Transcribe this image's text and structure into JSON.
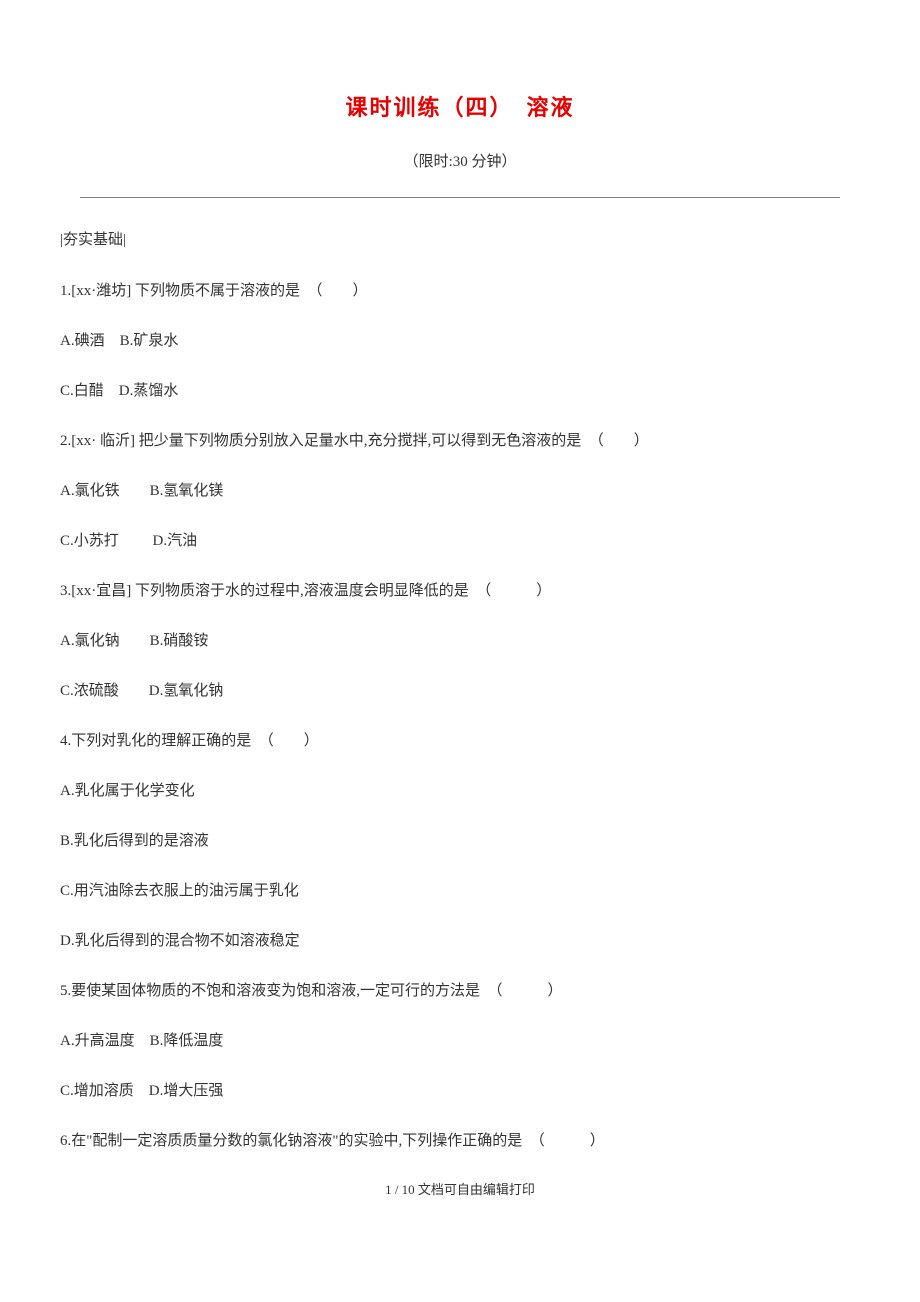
{
  "title": "课时训练（四）　溶液",
  "time_limit": "（限时:30 分钟）",
  "section_label": "|夯实基础|",
  "questions": [
    {
      "stem": "1.[xx·潍坊] 下列物质不属于溶液的是　（　　）",
      "options_line1": "A.碘酒　B.矿泉水",
      "options_line2": "C.白醋　D.蒸馏水"
    },
    {
      "stem": "2.[xx· 临沂] 把少量下列物质分别放入足量水中,充分搅拌,可以得到无色溶液的是　（　　）",
      "options_line1": "A.氯化铁　　B.氢氧化镁",
      "options_line2": "C.小苏打　 　D.汽油"
    },
    {
      "stem": "3.[xx·宜昌] 下列物质溶于水的过程中,溶液温度会明显降低的是　（　　　）",
      "options_line1": "A.氯化钠　　B.硝酸铵",
      "options_line2": "C.浓硫酸　　D.氢氧化钠"
    },
    {
      "stem": "4.下列对乳化的理解正确的是　（　　）",
      "opt_a": "A.乳化属于化学变化",
      "opt_b": "B.乳化后得到的是溶液",
      "opt_c": "C.用汽油除去衣服上的油污属于乳化",
      "opt_d": "D.乳化后得到的混合物不如溶液稳定"
    },
    {
      "stem": "5.要使某固体物质的不饱和溶液变为饱和溶液,一定可行的方法是　（　　　）",
      "options_line1": "A.升高温度　B.降低温度",
      "options_line2": "C.增加溶质　D.增大压强"
    },
    {
      "stem": "6.在\"配制一定溶质质量分数的氯化钠溶液\"的实验中,下列操作正确的是　（　　　）"
    }
  ],
  "footer": "1 / 10 文档可自由编辑打印"
}
